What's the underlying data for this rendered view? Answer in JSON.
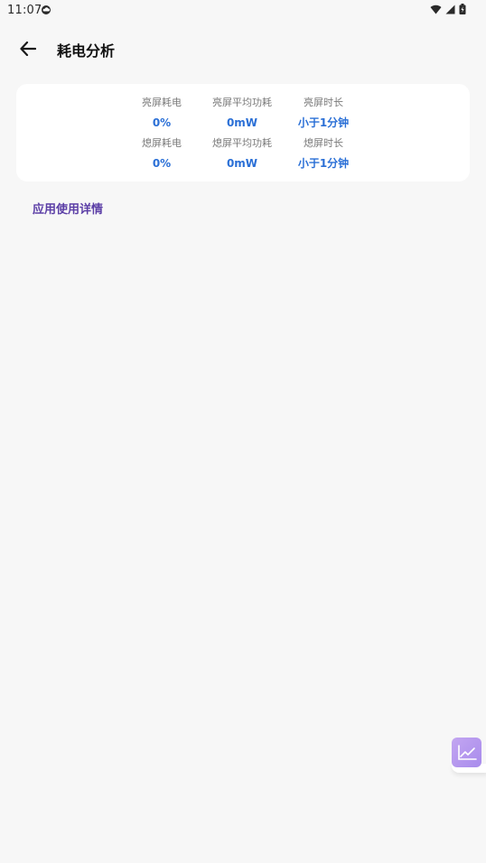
{
  "status_bar": {
    "time": "11:07",
    "icons": [
      "cloud-icon",
      "wifi-icon",
      "signal-icon",
      "battery-charging-icon"
    ]
  },
  "app_bar": {
    "title": "耗电分析",
    "back_icon": "arrow-left-icon"
  },
  "stats": {
    "screen_on_power_label": "亮屏耗电",
    "screen_on_power_value": "0%",
    "screen_on_avg_label": "亮屏平均功耗",
    "screen_on_avg_value": "0mW",
    "screen_on_time_label": "亮屏时长",
    "screen_on_time_value": "小于1分钟",
    "screen_off_power_label": "熄屏耗电",
    "screen_off_power_value": "0%",
    "screen_off_avg_label": "熄屏平均功耗",
    "screen_off_avg_value": "0mW",
    "screen_off_time_label": "熄屏时长",
    "screen_off_time_value": "小于1分钟"
  },
  "section": {
    "app_usage_details": "应用使用详情"
  },
  "floating_button": {
    "icon": "line-chart-icon",
    "accent_color": "#b295ee"
  },
  "colors": {
    "value_blue": "#2a6fd6",
    "link_purple": "#5b3ea6"
  }
}
